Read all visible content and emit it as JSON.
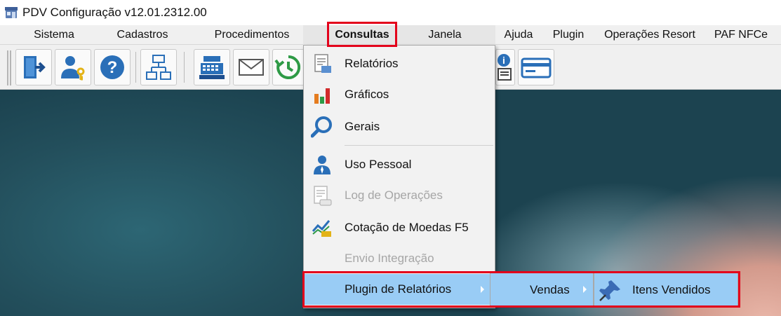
{
  "window": {
    "title": "PDV Configuração v12.01.2312.00",
    "app_icon": "store-icon"
  },
  "menubar": {
    "items": [
      {
        "label": "Sistema"
      },
      {
        "label": "Cadastros"
      },
      {
        "label": "Procedimentos"
      },
      {
        "label": "Consultas",
        "active": true
      },
      {
        "label": "Janela"
      },
      {
        "label": "Ajuda"
      },
      {
        "label": "Plugin"
      },
      {
        "label": "Operações Resort"
      },
      {
        "label": "PAF NFCe"
      }
    ]
  },
  "toolbar": {
    "buttons": [
      {
        "icon": "exit-door-icon"
      },
      {
        "icon": "user-key-icon"
      },
      {
        "icon": "help-question-icon"
      },
      {
        "icon": "network-diagram-icon"
      },
      {
        "icon": "cash-register-icon"
      },
      {
        "icon": "envelope-icon"
      },
      {
        "icon": "history-clock-icon"
      },
      {
        "icon": "info-document-icon"
      },
      {
        "icon": "credit-card-icon"
      }
    ]
  },
  "dropdown": {
    "items": [
      {
        "label": "Relatórios",
        "icon": "report-document-icon",
        "enabled": true
      },
      {
        "label": "Gráficos",
        "icon": "bar-chart-icon",
        "enabled": true
      },
      {
        "label": "Gerais",
        "icon": "magnifier-icon",
        "enabled": true
      },
      {
        "label": "Uso Pessoal",
        "icon": "person-icon",
        "enabled": true
      },
      {
        "label": "Log de Operações",
        "icon": "log-document-icon",
        "enabled": false
      },
      {
        "label": "Cotação de Moedas F5",
        "icon": "currency-chart-icon",
        "enabled": true
      },
      {
        "label": "Envio Integração",
        "icon": "",
        "enabled": false
      },
      {
        "label": "Plugin de Relatórios",
        "icon": "",
        "enabled": true,
        "has_submenu": true
      }
    ]
  },
  "submenu1": {
    "label": "Vendas",
    "has_submenu": true
  },
  "submenu2": {
    "label": "Itens Vendidos",
    "icon": "pushpin-icon"
  },
  "colors": {
    "highlight_red": "#e3001b",
    "hover_blue": "#99ccf5",
    "menu_bg": "#f2f2f2"
  }
}
